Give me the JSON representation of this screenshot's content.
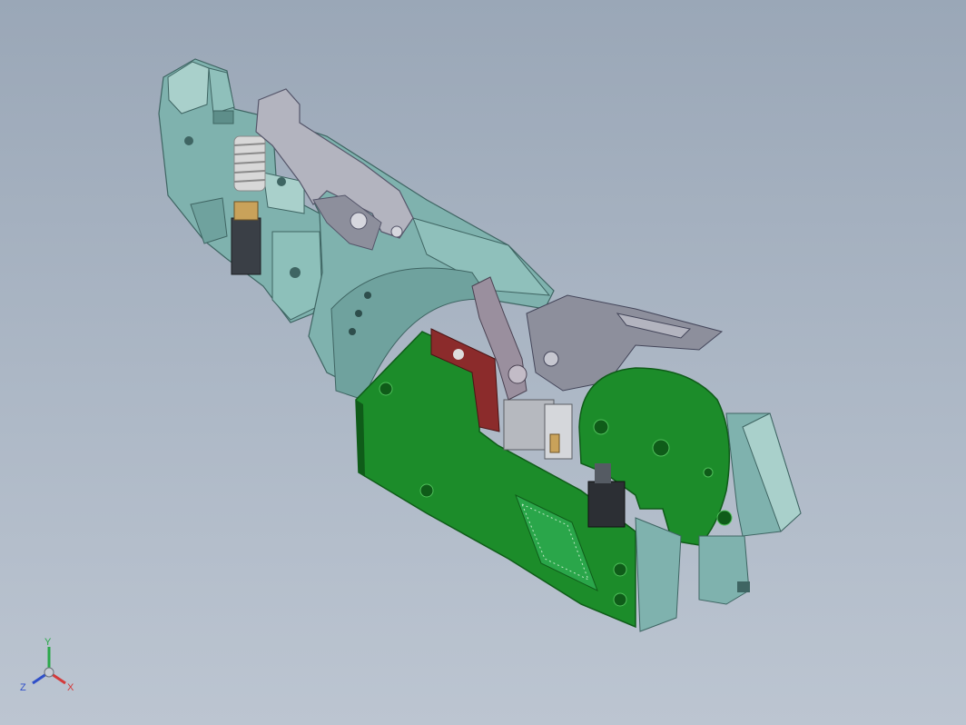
{
  "viewport": {
    "background_top": "#9aa7b7",
    "background_bottom": "#bcc5d1"
  },
  "colors": {
    "housing": "#7fb2ae",
    "housing_dark": "#4f7f7c",
    "housing_light": "#a9d0cb",
    "pcb": "#1c8c2a",
    "pcb_dark": "#0f5c19",
    "lever": "#8d8f9c",
    "lever_light": "#b3b4bf",
    "spring": "#cfcfcf",
    "contact": "#c9a25a",
    "board_red": "#8b2b2b"
  },
  "triad": {
    "y_label": "Y",
    "x_label": "X",
    "z_label": "Z",
    "y_color": "#2aa84a",
    "x_color": "#d43a3a",
    "z_color": "#2f4fc8"
  }
}
